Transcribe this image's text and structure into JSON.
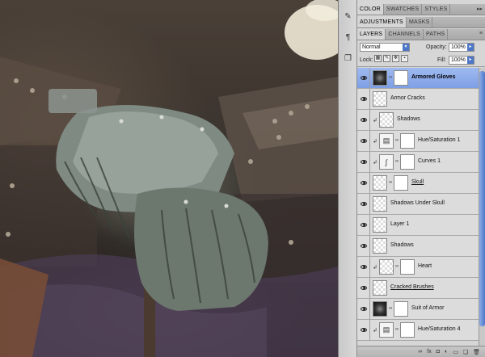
{
  "panels": {
    "top_tabs": [
      "COLOR",
      "SWATCHES",
      "STYLES"
    ],
    "mid_tabs": [
      "ADJUSTMENTS",
      "MASKS"
    ],
    "layer_tabs": [
      "LAYERS",
      "CHANNELS",
      "PATHS"
    ]
  },
  "options": {
    "blend_mode": "Normal",
    "opacity_label": "Opacity:",
    "opacity_value": "100%",
    "lock_label": "Lock:",
    "fill_label": "Fill:",
    "fill_value": "100%"
  },
  "layers": [
    {
      "name": "Armored Gloves",
      "selected": true
    },
    {
      "name": "Armor Cracks"
    },
    {
      "name": "Shadows"
    },
    {
      "name": "Hue/Saturation 1"
    },
    {
      "name": "Curves 1"
    },
    {
      "name": "Skull"
    },
    {
      "name": "Shadows Under Skull"
    },
    {
      "name": "Layer 1"
    },
    {
      "name": "Shadows"
    },
    {
      "name": "Heart"
    },
    {
      "name": "Cracked Brushes"
    },
    {
      "name": "Suit of Armor"
    },
    {
      "name": "Hue/Saturation 4"
    }
  ],
  "footer_icons": [
    "link-layers-icon",
    "fx-icon",
    "mask-icon",
    "adjustment-icon",
    "group-icon",
    "new-layer-icon",
    "trash-icon"
  ],
  "icons": {
    "footer_fx": "fx"
  }
}
